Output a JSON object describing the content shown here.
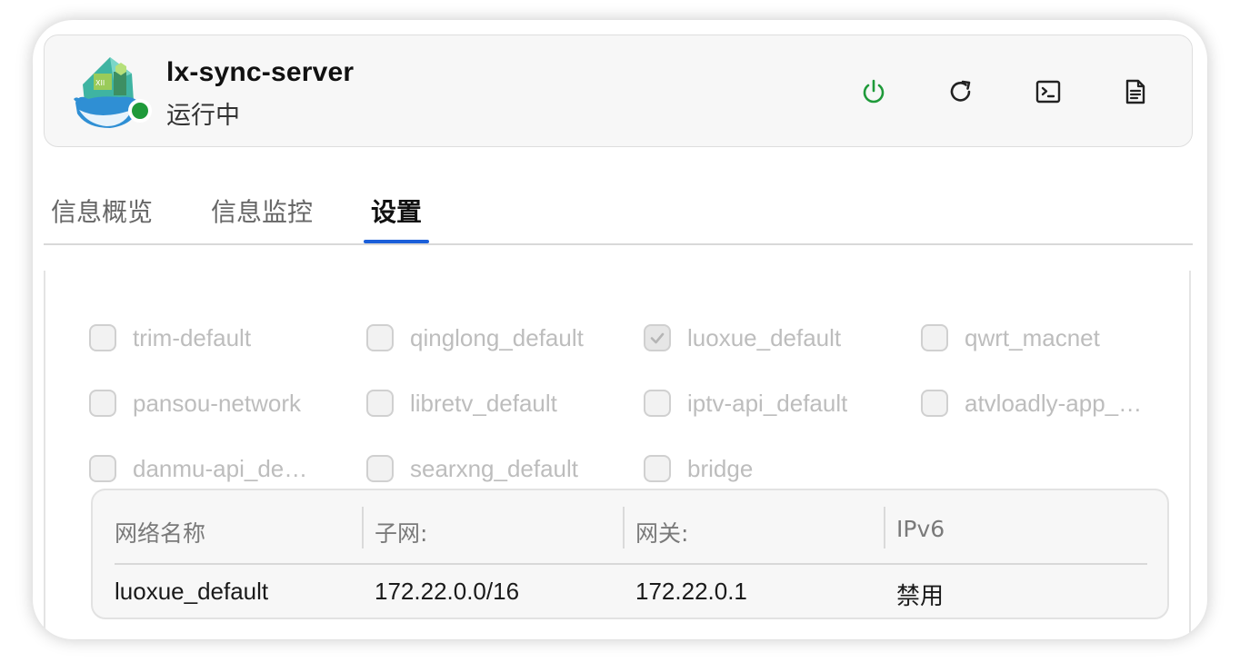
{
  "app": {
    "name": "lx-sync-server",
    "status": "运行中",
    "status_color": "#1f9a3a",
    "icon": "whale-container-app-icon"
  },
  "toolbar": {
    "power_icon": "power-icon",
    "power_color": "#1f9a3a",
    "restart_icon": "restart-icon",
    "terminal_icon": "terminal-icon",
    "log_icon": "document-icon"
  },
  "tabs": [
    {
      "label": "信息概览",
      "active": false
    },
    {
      "label": "信息监控",
      "active": false
    },
    {
      "label": "设置",
      "active": true
    }
  ],
  "accent_color": "#1b5fd9",
  "networks": [
    {
      "label": "trim-default",
      "checked": false
    },
    {
      "label": "qinglong_default",
      "checked": false
    },
    {
      "label": "luoxue_default",
      "checked": true
    },
    {
      "label": "qwrt_macnet",
      "checked": false
    },
    {
      "label": "pansou-network",
      "checked": false
    },
    {
      "label": "libretv_default",
      "checked": false
    },
    {
      "label": "iptv-api_default",
      "checked": false
    },
    {
      "label": "atvloadly-app_…",
      "checked": false
    },
    {
      "label": "danmu-api_de…",
      "checked": false
    },
    {
      "label": "searxng_default",
      "checked": false
    },
    {
      "label": "bridge",
      "checked": false
    }
  ],
  "network_table": {
    "headers": [
      "网络名称",
      "子网:",
      "网关:",
      "IPv6"
    ],
    "row": [
      "luoxue_default",
      "172.22.0.0/16",
      "172.22.0.1",
      "禁用"
    ]
  }
}
